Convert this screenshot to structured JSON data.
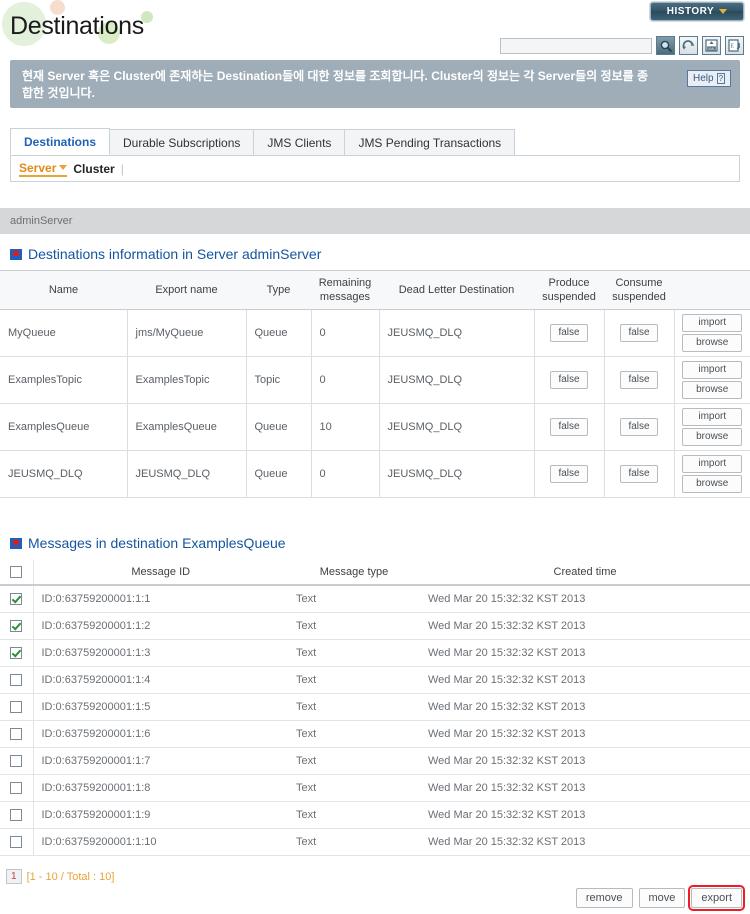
{
  "header": {
    "title": "Destinations",
    "history_label": "HISTORY",
    "help_label": "Help",
    "help_mark": "?",
    "description": "현재 Server 혹은 Cluster에 존재하는 Destination들에 대한 정보를 조회합니다. Cluster의 정보는 각 Server들의 정보를 종합한 것입니다."
  },
  "search": {
    "value": "",
    "placeholder": ""
  },
  "toolbar_icons": [
    {
      "name": "search-icon"
    },
    {
      "name": "refresh-icon"
    },
    {
      "name": "xml-export-icon"
    },
    {
      "name": "excel-export-icon"
    }
  ],
  "tabs": [
    {
      "label": "Destinations",
      "active": true
    },
    {
      "label": "Durable Subscriptions",
      "active": false
    },
    {
      "label": "JMS Clients",
      "active": false
    },
    {
      "label": "JMS Pending Transactions",
      "active": false
    }
  ],
  "subnav": {
    "items": [
      {
        "label": "Server",
        "selected": true
      },
      {
        "label": "Cluster",
        "selected": false
      }
    ],
    "separator": "|"
  },
  "server_bar": {
    "name": "adminServer"
  },
  "destinations_section": {
    "title": "Destinations information in Server adminServer",
    "columns": [
      "Name",
      "Export name",
      "Type",
      "Remaining messages",
      "Dead Letter Destination",
      "Produce suspended",
      "Consume suspended",
      ""
    ],
    "rows": [
      {
        "name": "MyQueue",
        "export_name": "jms/MyQueue",
        "type": "Queue",
        "remaining": "0",
        "dlq": "JEUSMQ_DLQ",
        "produce_suspended": "false",
        "consume_suspended": "false",
        "import_label": "import",
        "browse_label": "browse"
      },
      {
        "name": "ExamplesTopic",
        "export_name": "ExamplesTopic",
        "type": "Topic",
        "remaining": "0",
        "dlq": "JEUSMQ_DLQ",
        "produce_suspended": "false",
        "consume_suspended": "false",
        "import_label": "import",
        "browse_label": "browse"
      },
      {
        "name": "ExamplesQueue",
        "export_name": "ExamplesQueue",
        "type": "Queue",
        "remaining": "10",
        "dlq": "JEUSMQ_DLQ",
        "produce_suspended": "false",
        "consume_suspended": "false",
        "import_label": "import",
        "browse_label": "browse"
      },
      {
        "name": "JEUSMQ_DLQ",
        "export_name": "JEUSMQ_DLQ",
        "type": "Queue",
        "remaining": "0",
        "dlq": "JEUSMQ_DLQ",
        "produce_suspended": "false",
        "consume_suspended": "false",
        "import_label": "import",
        "browse_label": "browse"
      }
    ]
  },
  "messages_section": {
    "title": "Messages in destination ExamplesQueue",
    "columns": [
      "",
      "Message ID",
      "Message type",
      "Created time"
    ],
    "select_all_checked": false,
    "rows": [
      {
        "checked": true,
        "id": "ID:0:63759200001:1:1",
        "type": "Text",
        "created": "Wed Mar 20 15:32:32 KST 2013"
      },
      {
        "checked": true,
        "id": "ID:0:63759200001:1:2",
        "type": "Text",
        "created": "Wed Mar 20 15:32:32 KST 2013"
      },
      {
        "checked": true,
        "id": "ID:0:63759200001:1:3",
        "type": "Text",
        "created": "Wed Mar 20 15:32:32 KST 2013"
      },
      {
        "checked": false,
        "id": "ID:0:63759200001:1:4",
        "type": "Text",
        "created": "Wed Mar 20 15:32:32 KST 2013"
      },
      {
        "checked": false,
        "id": "ID:0:63759200001:1:5",
        "type": "Text",
        "created": "Wed Mar 20 15:32:32 KST 2013"
      },
      {
        "checked": false,
        "id": "ID:0:63759200001:1:6",
        "type": "Text",
        "created": "Wed Mar 20 15:32:32 KST 2013"
      },
      {
        "checked": false,
        "id": "ID:0:63759200001:1:7",
        "type": "Text",
        "created": "Wed Mar 20 15:32:32 KST 2013"
      },
      {
        "checked": false,
        "id": "ID:0:63759200001:1:8",
        "type": "Text",
        "created": "Wed Mar 20 15:32:32 KST 2013"
      },
      {
        "checked": false,
        "id": "ID:0:63759200001:1:9",
        "type": "Text",
        "created": "Wed Mar 20 15:32:32 KST 2013"
      },
      {
        "checked": false,
        "id": "ID:0:63759200001:1:10",
        "type": "Text",
        "created": "Wed Mar 20 15:32:32 KST 2013"
      }
    ]
  },
  "pager": {
    "current_page": "1",
    "info": "[1 - 10 / Total : 10]"
  },
  "footer_buttons": [
    {
      "label": "remove",
      "highlighted": false
    },
    {
      "label": "move",
      "highlighted": false
    },
    {
      "label": "export",
      "highlighted": true
    }
  ],
  "colors": {
    "accent_blue": "#15559e",
    "tab_active": "#1f63b5",
    "orange": "#e8a33a",
    "highlight_red": "#ee1c25",
    "banner_gray": "#9fadb8"
  }
}
